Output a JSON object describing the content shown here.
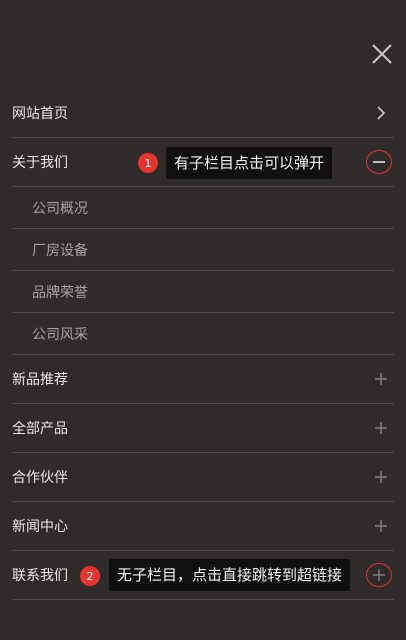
{
  "nav": {
    "items": [
      {
        "label": "网站首页",
        "icon": "chevron-right-icon"
      },
      {
        "label": "关于我们",
        "icon": "minus-icon",
        "expanded": true,
        "children": [
          {
            "label": "公司概况"
          },
          {
            "label": "厂房设备"
          },
          {
            "label": "品牌荣誉"
          },
          {
            "label": "公司风采"
          }
        ]
      },
      {
        "label": "新品推荐",
        "icon": "plus-icon"
      },
      {
        "label": "全部产品",
        "icon": "plus-icon"
      },
      {
        "label": "合作伙伴",
        "icon": "plus-icon"
      },
      {
        "label": "新闻中心",
        "icon": "plus-icon"
      },
      {
        "label": "联系我们",
        "icon": "plus-icon"
      }
    ]
  },
  "annotations": [
    {
      "number": "1",
      "text": "有子栏目点击可以弹开"
    },
    {
      "number": "2",
      "text": "无子栏目，点击直接跳转到超链接"
    }
  ],
  "colors": {
    "background": "#2e2b2a",
    "divider": "#4d4947",
    "annotation_red": "#e3342f",
    "tooltip_bg": "#111010"
  },
  "icons": {
    "close": "close-icon"
  }
}
